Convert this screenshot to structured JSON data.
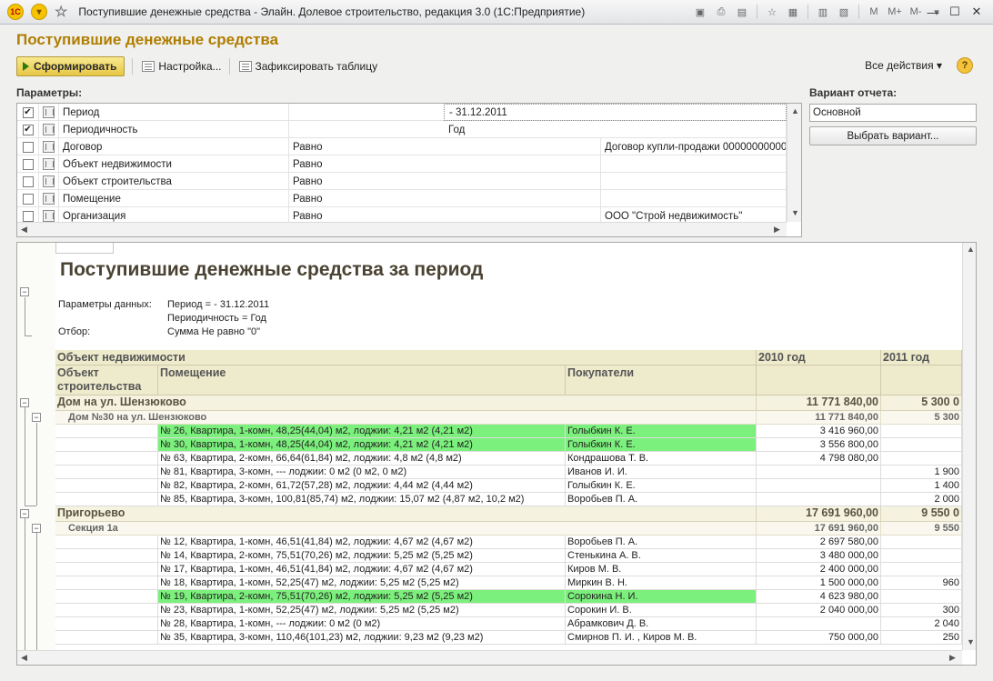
{
  "window": {
    "title": "Поступившие денежные средства - Элайн. Долевое строительство, редакция 3.0  (1С:Предприятие)",
    "app_badge": "1С",
    "tools": [
      "M",
      "M+",
      "M-"
    ]
  },
  "page": {
    "title": "Поступившие денежные средства"
  },
  "toolbar": {
    "generate_label": "Сформировать",
    "settings_label": "Настройка...",
    "fix_table_label": "Зафиксировать таблицу",
    "all_actions_label": "Все действия",
    "help_label": "?"
  },
  "params": {
    "label": "Параметры:",
    "rows": [
      {
        "checked": true,
        "name": "Период",
        "condition": "- 31.12.2011",
        "value": ""
      },
      {
        "checked": true,
        "name": "Периодичность",
        "condition": "Год",
        "value": ""
      },
      {
        "checked": false,
        "name": "Договор",
        "condition": "Равно",
        "value": "Договор купли-продажи 000000000000"
      },
      {
        "checked": false,
        "name": "Объект недвижимости",
        "condition": "Равно",
        "value": ""
      },
      {
        "checked": false,
        "name": "Объект строительства",
        "condition": "Равно",
        "value": ""
      },
      {
        "checked": false,
        "name": "Помещение",
        "condition": "Равно",
        "value": ""
      },
      {
        "checked": false,
        "name": "Организация",
        "condition": "Равно",
        "value": "ООО \"Строй недвижимость\""
      }
    ]
  },
  "variant": {
    "label": "Вариант отчета:",
    "value": "Основной",
    "choose_label": "Выбрать вариант..."
  },
  "report": {
    "title": "Поступившие денежные средства за период",
    "data_params_label": "Параметры данных:",
    "data_params": [
      "Период =  - 31.12.2011",
      "Периодичность = Год"
    ],
    "filter_label": "Отбор:",
    "filter_value": "Сумма Не равно \"0\"",
    "headers": {
      "object": "Объект недвижимости",
      "building": "Объект строительства",
      "premises": "Помещение",
      "buyers": "Покупатели",
      "y2010": "2010 год",
      "y2011": "2011 год"
    },
    "rows": [
      {
        "kind": "grp1",
        "name": "Дом на ул. Шензюково",
        "v2010": "11 771 840,00",
        "v2011": "5 300 0"
      },
      {
        "kind": "grp2",
        "name": "Дом №30 на ул. Шензюково",
        "v2010": "11 771 840,00",
        "v2011": "5 300"
      },
      {
        "kind": "item",
        "premises": "№ 26, Квартира, 1-комн, 48,25(44,04)  м2, лоджии: 4,21 м2  (4,21 м2)",
        "buyer": "Голыбкин К. Е.",
        "v2010": "3 416 960,00",
        "v2011": "",
        "highlight": true
      },
      {
        "kind": "item",
        "premises": "№ 30, Квартира, 1-комн, 48,25(44,04)  м2, лоджии: 4,21 м2  (4,21 м2)",
        "buyer": "Голыбкин К. Е.",
        "v2010": "3 556 800,00",
        "v2011": "",
        "highlight": true
      },
      {
        "kind": "item",
        "premises": "№ 63, Квартира, 2-комн, 66,64(61,84)  м2, лоджии: 4,8 м2  (4,8 м2)",
        "buyer": "Кондрашова Т. В.",
        "v2010": "4 798 080,00",
        "v2011": "",
        "highlight": false
      },
      {
        "kind": "item",
        "premises": "№ 81, Квартира, 3-комн, --- лоджии: 0 м2  (0 м2, 0 м2)",
        "buyer": "Иванов И. И.",
        "v2010": "",
        "v2011": "1 900",
        "highlight": false
      },
      {
        "kind": "item",
        "premises": "№ 82, Квартира, 2-комн, 61,72(57,28)  м2, лоджии: 4,44 м2  (4,44 м2)",
        "buyer": "Голыбкин К. Е.",
        "v2010": "",
        "v2011": "1 400",
        "highlight": false
      },
      {
        "kind": "item",
        "premises": "№ 85, Квартира, 3-комн, 100,81(85,74)  м2, лоджии: 15,07 м2  (4,87 м2, 10,2 м2)",
        "buyer": "Воробьев П. А.",
        "v2010": "",
        "v2011": "2 000",
        "highlight": false
      },
      {
        "kind": "grp1",
        "name": "Пригорьево",
        "v2010": "17 691 960,00",
        "v2011": "9 550 0"
      },
      {
        "kind": "grp2",
        "name": "Секция 1а",
        "v2010": "17 691 960,00",
        "v2011": "9 550"
      },
      {
        "kind": "item",
        "premises": "№ 12, Квартира, 1-комн, 46,51(41,84)  м2, лоджии: 4,67 м2  (4,67 м2)",
        "buyer": "Воробьев П. А.",
        "v2010": "2 697 580,00",
        "v2011": "",
        "highlight": false
      },
      {
        "kind": "item",
        "premises": "№ 14, Квартира, 2-комн, 75,51(70,26)  м2, лоджии: 5,25 м2  (5,25 м2)",
        "buyer": "Стенькина А. В.",
        "v2010": "3 480 000,00",
        "v2011": "",
        "highlight": false
      },
      {
        "kind": "item",
        "premises": "№ 17, Квартира, 1-комн, 46,51(41,84)  м2, лоджии: 4,67 м2  (4,67 м2)",
        "buyer": "Киров М. В.",
        "v2010": "2 400 000,00",
        "v2011": "",
        "highlight": false
      },
      {
        "kind": "item",
        "premises": "№ 18, Квартира, 1-комн, 52,25(47)  м2, лоджии: 5,25 м2  (5,25 м2)",
        "buyer": "Миркин В. Н.",
        "v2010": "1 500 000,00",
        "v2011": "960",
        "highlight": false
      },
      {
        "kind": "item",
        "premises": "№ 19, Квартира, 2-комн, 75,51(70,26)  м2, лоджии: 5,25 м2  (5,25 м2)",
        "buyer": "Сорокина Н. И.",
        "v2010": "4 623 980,00",
        "v2011": "",
        "highlight": true
      },
      {
        "kind": "item",
        "premises": "№ 23, Квартира, 1-комн, 52,25(47)  м2, лоджии: 5,25 м2  (5,25 м2)",
        "buyer": "Сорокин И. В.",
        "v2010": "2 040 000,00",
        "v2011": "300",
        "highlight": false
      },
      {
        "kind": "item",
        "premises": "№ 28, Квартира, 1-комн, --- лоджии: 0 м2  (0 м2)",
        "buyer": "Абрамкович Д. В.",
        "v2010": "",
        "v2011": "2 040",
        "highlight": false
      },
      {
        "kind": "item",
        "premises": "№ 35, Квартира, 3-комн, 110,46(101,23)  м2, лоджии: 9,23 м2  (9,23 м2)",
        "buyer": "Смирнов П. И. , Киров М. В.",
        "v2010": "750 000,00",
        "v2011": "250",
        "highlight": false
      }
    ]
  },
  "colors": {
    "title": "#b07d00",
    "header_bg": "#eeeacc",
    "highlight": "#7cf07c",
    "primary_button": "#e7c645"
  }
}
